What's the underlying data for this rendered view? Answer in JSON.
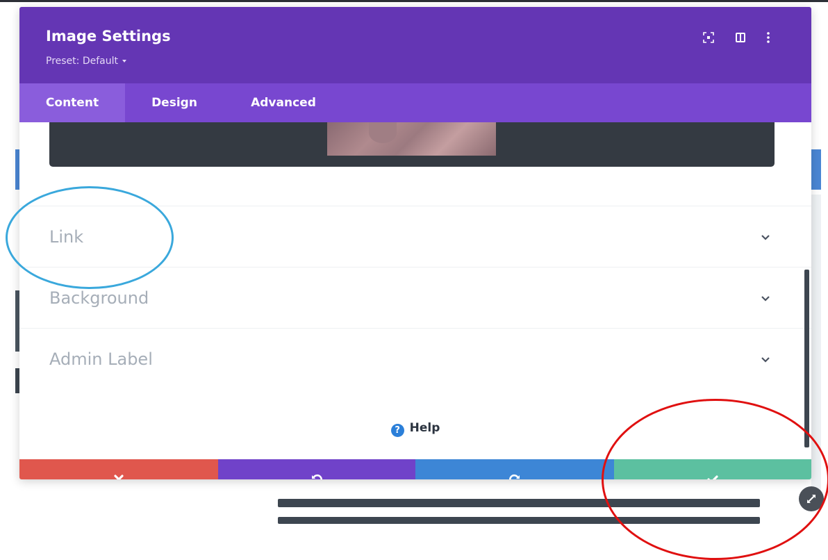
{
  "modal": {
    "title": "Image Settings",
    "preset_label": "Preset: Default"
  },
  "tabs": [
    {
      "label": "Content",
      "active": true
    },
    {
      "label": "Design",
      "active": false
    },
    {
      "label": "Advanced",
      "active": false
    }
  ],
  "sections": [
    {
      "label": "Link"
    },
    {
      "label": "Background"
    },
    {
      "label": "Admin Label"
    }
  ],
  "help": {
    "label": "Help"
  },
  "footer": {
    "discard_color": "#e0574d",
    "undo_color": "#7042c9",
    "redo_color": "#3d86d6",
    "save_color": "#5cc0a0"
  },
  "colors": {
    "header": "#6436b4",
    "tabs_bar": "#7847d0",
    "annotation_blue": "#3aa8dc",
    "annotation_red": "#e01010"
  }
}
